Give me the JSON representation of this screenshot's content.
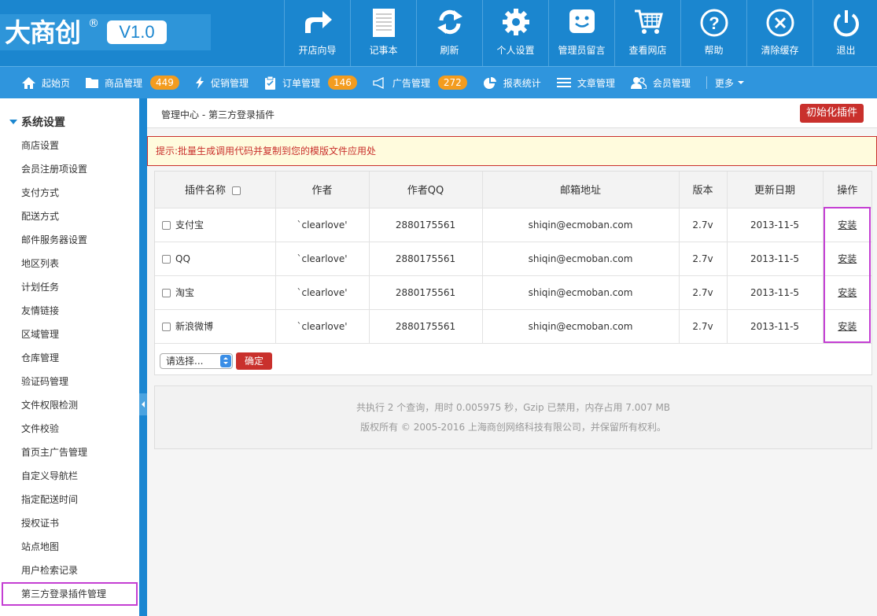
{
  "logo": {
    "text": "大商创",
    "reg": "®",
    "version": "V1.0"
  },
  "toolbar": [
    {
      "icon": "share-arrow-icon",
      "label": "开店向导"
    },
    {
      "icon": "notepad-icon",
      "label": "记事本"
    },
    {
      "icon": "refresh-icon",
      "label": "刷新"
    },
    {
      "icon": "gear-icon",
      "label": "个人设置"
    },
    {
      "icon": "message-icon",
      "label": "管理员留言"
    },
    {
      "icon": "cart-icon",
      "label": "查看网店"
    },
    {
      "icon": "help-icon",
      "label": "帮助"
    },
    {
      "icon": "clear-cache-icon",
      "label": "清除缓存"
    },
    {
      "icon": "power-icon",
      "label": "退出"
    }
  ],
  "nav": [
    {
      "icon": "home-icon",
      "label": "起始页"
    },
    {
      "icon": "folder-icon",
      "label": "商品管理",
      "badge": "449"
    },
    {
      "icon": "lightning-icon",
      "label": "促销管理"
    },
    {
      "icon": "clipboard-icon",
      "label": "订单管理",
      "badge": "146"
    },
    {
      "icon": "megaphone-icon",
      "label": "广告管理",
      "badge": "272"
    },
    {
      "icon": "pie-chart-icon",
      "label": "报表统计"
    },
    {
      "icon": "list-icon",
      "label": "文章管理"
    },
    {
      "icon": "users-icon",
      "label": "会员管理"
    },
    {
      "label": "更多"
    }
  ],
  "sidebar": {
    "title": "系统设置",
    "items": [
      "商店设置",
      "会员注册项设置",
      "支付方式",
      "配送方式",
      "邮件服务器设置",
      "地区列表",
      "计划任务",
      "友情链接",
      "区域管理",
      "仓库管理",
      "验证码管理",
      "文件权限检测",
      "文件校验",
      "首页主广告管理",
      "自定义导航栏",
      "指定配送时间",
      "授权证书",
      "站点地图",
      "用户检索记录",
      "第三方登录插件管理"
    ]
  },
  "breadcrumb": {
    "root": "管理中心",
    "sep": " - ",
    "current": "第三方登录插件"
  },
  "init_button": "初始化插件",
  "tip": "提示:批量生成调用代码并复制到您的模版文件应用处",
  "table": {
    "headers": [
      "插件名称",
      "作者",
      "作者QQ",
      "邮箱地址",
      "版本",
      "更新日期",
      "操作"
    ],
    "rows": [
      {
        "name": "支付宝",
        "author": "`clearlove'",
        "qq": "2880175561",
        "email": "shiqin@ecmoban.com",
        "version": "2.7v",
        "date": "2013-11-5",
        "action": "安装"
      },
      {
        "name": "QQ",
        "author": "`clearlove'",
        "qq": "2880175561",
        "email": "shiqin@ecmoban.com",
        "version": "2.7v",
        "date": "2013-11-5",
        "action": "安装"
      },
      {
        "name": "淘宝",
        "author": "`clearlove'",
        "qq": "2880175561",
        "email": "shiqin@ecmoban.com",
        "version": "2.7v",
        "date": "2013-11-5",
        "action": "安装"
      },
      {
        "name": "新浪微博",
        "author": "`clearlove'",
        "qq": "2880175561",
        "email": "shiqin@ecmoban.com",
        "version": "2.7v",
        "date": "2013-11-5",
        "action": "安装"
      }
    ]
  },
  "batch": {
    "select": "请选择...",
    "ok": "确定"
  },
  "footer": {
    "line1": "共执行 2 个查询，用时 0.005975 秒，Gzip 已禁用，内存占用 7.007 MB",
    "line2": "版权所有 © 2005-2016 上海商创网络科技有限公司，并保留所有权利。"
  }
}
